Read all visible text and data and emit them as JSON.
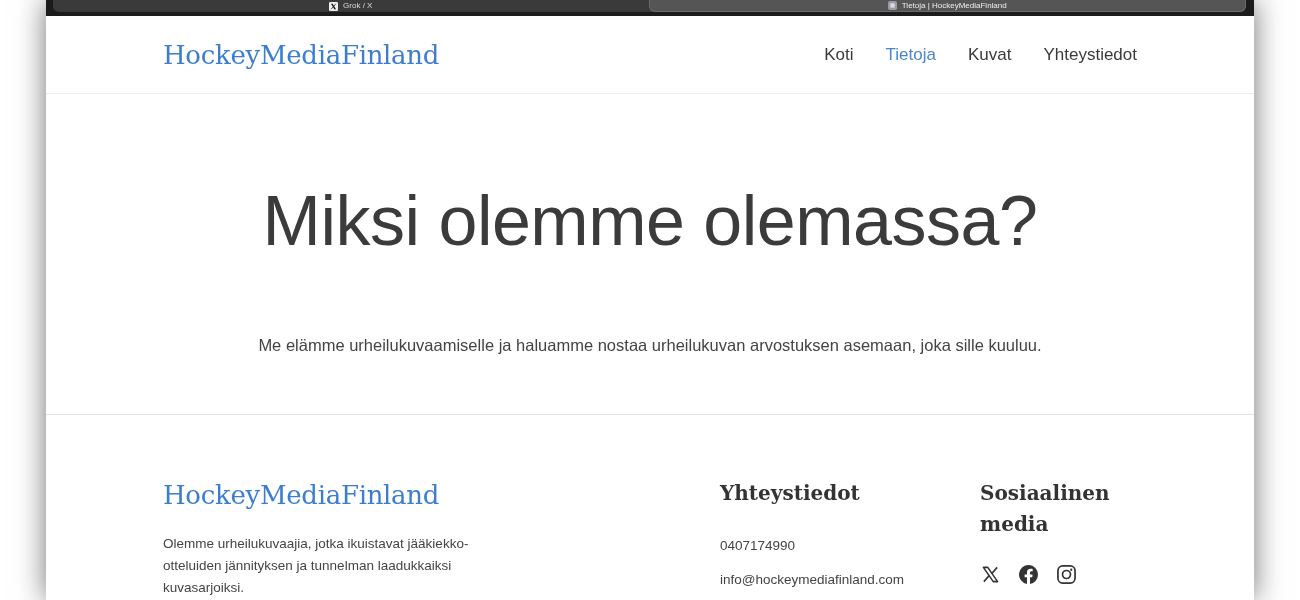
{
  "browser_tabs": [
    {
      "title": "Grok / X",
      "kind": "x",
      "selected": false
    },
    {
      "title": "Tietoja | HockeyMediaFinland",
      "kind": "site",
      "selected": true
    }
  ],
  "header": {
    "logo": "HockeyMediaFinland",
    "nav": [
      {
        "label": "Koti",
        "selected": false
      },
      {
        "label": "Tietoja",
        "selected": true
      },
      {
        "label": "Kuvat",
        "selected": false
      },
      {
        "label": "Yhteystiedot",
        "selected": false
      }
    ]
  },
  "hero": {
    "title": "Miksi olemme olemassa?",
    "text": "Me elämme urheilukuvaamiselle ja haluamme nostaa urheilukuvan arvostuksen asemaan, joka sille kuuluu."
  },
  "footer": {
    "about": {
      "logo": "HockeyMediaFinland",
      "text": "Olemme urheilukuvaajia, jotka ikuistavat jääkiekko-otteluiden jännityksen ja tunnelman laadukkaiksi kuvasarjoiksi."
    },
    "contact": {
      "heading": "Yhteystiedot",
      "phone": "0407174990",
      "email": "info@hockeymediafinland.com"
    },
    "social": {
      "heading": "Sosiaalinen media",
      "links": [
        {
          "kind": "x"
        },
        {
          "kind": "facebook"
        },
        {
          "kind": "instagram"
        }
      ]
    }
  }
}
